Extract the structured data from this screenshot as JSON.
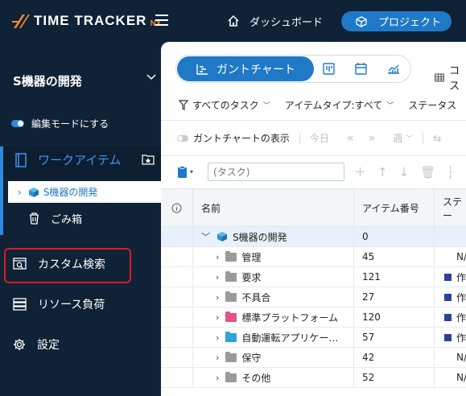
{
  "app": {
    "logo_text": "TIME TRACKER",
    "logo_suffix": "NX"
  },
  "header": {
    "dashboard_label": "ダッシュボード",
    "project_label": "プロジェクト"
  },
  "sidebar": {
    "project_name": "S機器の開発",
    "edit_mode_label": "編集モードにする",
    "work_item_label": "ワークアイテム",
    "tree_selected": "S機器の開発",
    "trash_label": "ごみ箱",
    "custom_search_label": "カスタム検索",
    "resource_load_label": "リソース負荷",
    "settings_label": "設定"
  },
  "toolbar": {
    "gantt_label": "ガントチャート",
    "cost_label": "コス"
  },
  "filters": {
    "all_tasks": "すべてのタスク",
    "item_type": "アイテムタイプ:すべて",
    "status": "ステータス"
  },
  "gantt_controls": {
    "show_gantt_label": "ガントチャートの表示",
    "today_label": "今日",
    "week_label": "週"
  },
  "search": {
    "placeholder": "(タスク)"
  },
  "table": {
    "columns": {
      "name": "名前",
      "item_number": "アイテム番号",
      "status": "ステー"
    },
    "root": {
      "name": "S機器の開発",
      "number": "0"
    },
    "rows": [
      {
        "name": "管理",
        "number": "45",
        "status": "N/",
        "folder_color": "#9a9a9a",
        "status_color": ""
      },
      {
        "name": "要求",
        "number": "121",
        "status": "作",
        "folder_color": "#9a9a9a",
        "status_color": "#2e3f9c"
      },
      {
        "name": "不具合",
        "number": "27",
        "status": "作",
        "folder_color": "#9a9a9a",
        "status_color": "#2e3f9c"
      },
      {
        "name": "標準プラットフォーム",
        "number": "120",
        "status": "作",
        "folder_color": "#e8508a",
        "status_color": "#2e3f9c"
      },
      {
        "name": "自動運転アプリケー…",
        "number": "57",
        "status": "作",
        "folder_color": "#2fa3d8",
        "status_color": "#2e3f9c"
      },
      {
        "name": "保守",
        "number": "42",
        "status": "N/",
        "folder_color": "#9a9a9a",
        "status_color": ""
      },
      {
        "name": "その他",
        "number": "52",
        "status": "N/",
        "folder_color": "#9a9a9a",
        "status_color": ""
      }
    ]
  },
  "colors": {
    "accent": "#1f79c7",
    "sidebar_bg": "#0f2236",
    "highlight_border": "#e0182b",
    "logo_accent": "#f28a2e"
  }
}
